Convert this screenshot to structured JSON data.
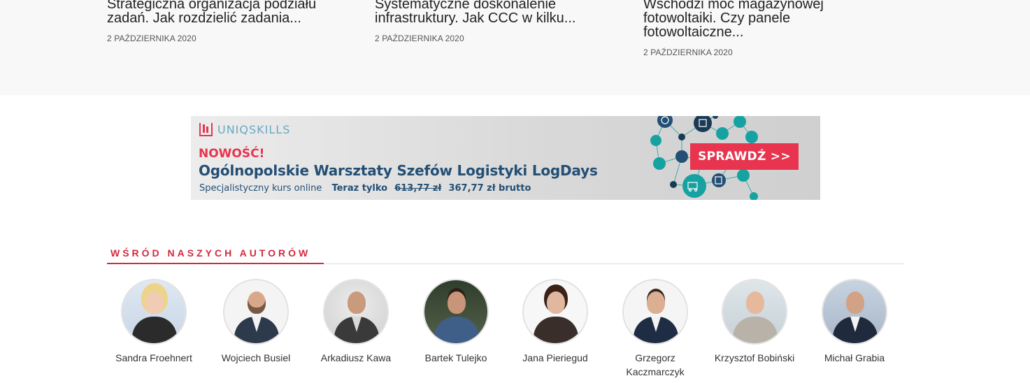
{
  "articles": [
    {
      "title": "Strategiczna organizacja podziału zadań. Jak rozdzielić zadania...",
      "date": "2 PAŹDZIERNIKA 2020"
    },
    {
      "title": "Systematyczne doskonalenie infrastruktury. Jak CCC w kilku...",
      "date": "2 PAŹDZIERNIKA 2020"
    },
    {
      "title": "Wschodzi moc magazynowej fotowoltaiki. Czy panele fotowoltaiczne...",
      "date": "2 PAŹDZIERNIKA 2020"
    }
  ],
  "banner": {
    "logo_text": "UNIQSKILLS",
    "new_label": "NOWOŚĆ!",
    "heading": "Ogólnopolskie Warsztaty Szefów Logistyki LogDays",
    "subtitle": "Specjalistyczny kurs online",
    "price_lead": "Teraz tylko",
    "old_price": "613,77 zł",
    "new_price": "367,77 zł brutto",
    "cta": "SPRAWDŹ >>",
    "colors": {
      "accent": "#e8344e",
      "navy": "#244f74",
      "teal": "#17a2a2"
    }
  },
  "authors_section": {
    "title": "WŚRÓD NASZYCH AUTORÓW",
    "accent_color": "#d32a3d",
    "authors": [
      {
        "name": "Sandra Froehnert"
      },
      {
        "name": "Wojciech Busiel"
      },
      {
        "name": "Arkadiusz Kawa"
      },
      {
        "name": "Bartek Tulejko"
      },
      {
        "name": "Jana Pieriegud"
      },
      {
        "name": "Grzegorz Kaczmarczyk"
      },
      {
        "name": "Krzysztof Bobiński"
      },
      {
        "name": "Michał Grabia"
      }
    ]
  }
}
